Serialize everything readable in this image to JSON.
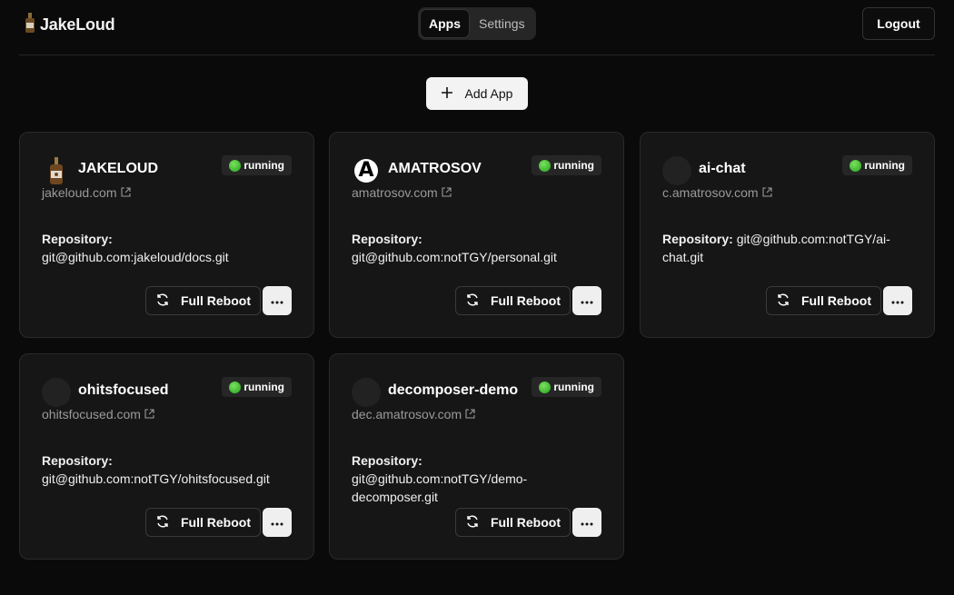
{
  "header": {
    "brand": "JakeLoud",
    "nav_tabs": [
      {
        "label": "Apps",
        "active": true
      },
      {
        "label": "Settings",
        "active": false
      }
    ],
    "logout_label": "Logout"
  },
  "toolbar": {
    "add_app_label": "Add App"
  },
  "colors": {
    "background": "#0a0a0a",
    "card": "#161616",
    "status_running": "#2fbf2a"
  },
  "apps": [
    {
      "name": "JAKELOUD",
      "logo": "bottle-icon",
      "status": "running",
      "domain": "jakeloud.com",
      "repo_label": "Repository:",
      "repo": "git@github.com:jakeloud/docs.git",
      "reboot_label": "Full Reboot"
    },
    {
      "name": "AMATROSOV",
      "logo": "letter-a-icon",
      "logo_text": "A",
      "status": "running",
      "domain": "amatrosov.com",
      "repo_label": "Repository:",
      "repo": "git@github.com:notTGY/personal.git",
      "reboot_label": "Full Reboot"
    },
    {
      "name": "ai-chat",
      "logo": "placeholder-avatar",
      "status": "running",
      "domain": "c.amatrosov.com",
      "repo_label": "Repository:",
      "repo": "git@github.com:notTGY/ai-chat.git",
      "reboot_label": "Full Reboot"
    },
    {
      "name": "ohitsfocused",
      "logo": "placeholder-avatar",
      "status": "running",
      "domain": "ohitsfocused.com",
      "repo_label": "Repository:",
      "repo": "git@github.com:notTGY/ohitsfocused.git",
      "reboot_label": "Full Reboot"
    },
    {
      "name": "decomposer-demo",
      "logo": "placeholder-avatar",
      "status": "running",
      "domain": "dec.amatrosov.com",
      "repo_label": "Repository:",
      "repo": "git@github.com:notTGY/demo-decomposer.git",
      "reboot_label": "Full Reboot"
    }
  ]
}
